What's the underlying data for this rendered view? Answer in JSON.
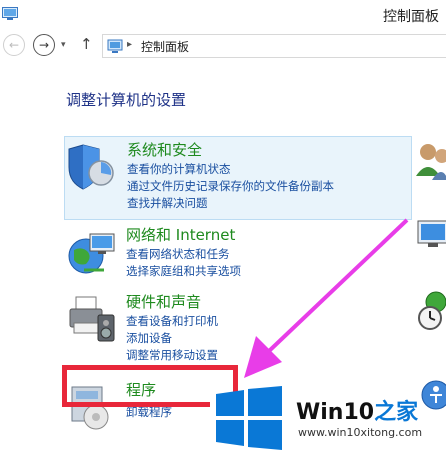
{
  "window": {
    "title": "控制面板"
  },
  "address": {
    "breadcrumb": "控制面板",
    "separator": "▸"
  },
  "nav": {
    "back_glyph": "←",
    "forward_glyph": "→",
    "dropdown_glyph": "▾",
    "up_glyph": "↑"
  },
  "main": {
    "heading": "调整计算机的设置",
    "categories": [
      {
        "title": "系统和安全",
        "icon": "shield-icon",
        "links": [
          "查看你的计算机状态",
          "通过文件历史记录保存你的文件备份副本",
          "查找并解决问题"
        ],
        "highlighted": true
      },
      {
        "title": "网络和 Internet",
        "icon": "network-globe-icon",
        "links": [
          "查看网络状态和任务",
          "选择家庭组和共享选项"
        ]
      },
      {
        "title": "硬件和声音",
        "icon": "printer-speaker-icon",
        "links": [
          "查看设备和打印机",
          "添加设备",
          "调整常用移动设置"
        ]
      },
      {
        "title": "程序",
        "icon": "programs-icon",
        "links": [
          "卸载程序"
        ]
      }
    ]
  },
  "annotation": {
    "box_color": "#e8273a",
    "arrow_color": "#e83de8"
  },
  "watermark": {
    "brand_prefix": "Win10",
    "brand_suffix": "之家",
    "url": "www.win10xitong.com"
  },
  "colors": {
    "heading": "#1e3287",
    "category_title": "#1e8a1e",
    "link": "#1a4fa0",
    "highlight_bg": "#e9f4fb",
    "windows_blue": "#0a78d6"
  }
}
